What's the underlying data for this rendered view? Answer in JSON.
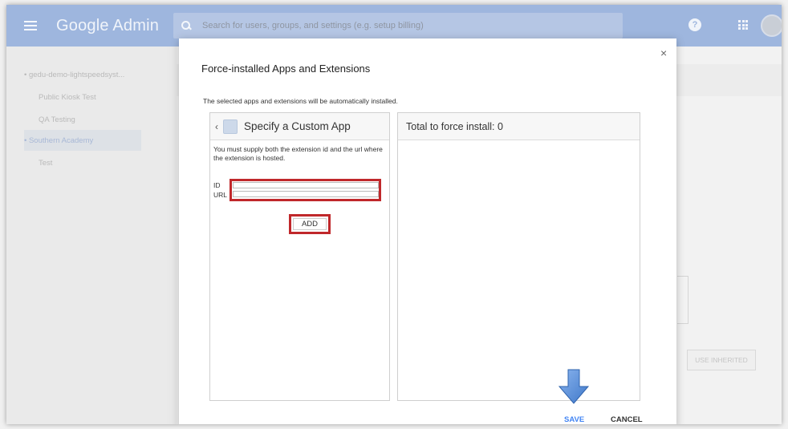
{
  "topbar": {
    "brand": "Google Admin",
    "search_placeholder": "Search for users, groups, and settings (e.g. setup billing)"
  },
  "sidebar": {
    "items": [
      {
        "label": "• gedu-demo-lightspeedsyst..."
      },
      {
        "label": "Public Kiosk Test"
      },
      {
        "label": "QA Testing"
      },
      {
        "label": "• Southern Academy"
      },
      {
        "label": "Test"
      }
    ]
  },
  "background": {
    "use_inherited_label": "USE INHERITED"
  },
  "dialog": {
    "title": "Force-installed Apps and Extensions",
    "description": "The selected apps and extensions will be automatically installed.",
    "close_label": "×",
    "left_panel": {
      "title": "Specify a Custom App",
      "back_label": "‹",
      "instructions": "You must supply both the extension id and the url where the extension is hosted.",
      "id_label": "ID",
      "url_label": "URL",
      "id_value": "",
      "url_value": "",
      "add_label": "ADD"
    },
    "right_panel": {
      "title": "Total to force install: 0"
    },
    "save_label": "SAVE",
    "cancel_label": "CANCEL"
  },
  "colors": {
    "topbar": "#9eb6de",
    "highlight": "#c0282b",
    "save": "#4285f4",
    "arrow": "#5b8fd8"
  }
}
